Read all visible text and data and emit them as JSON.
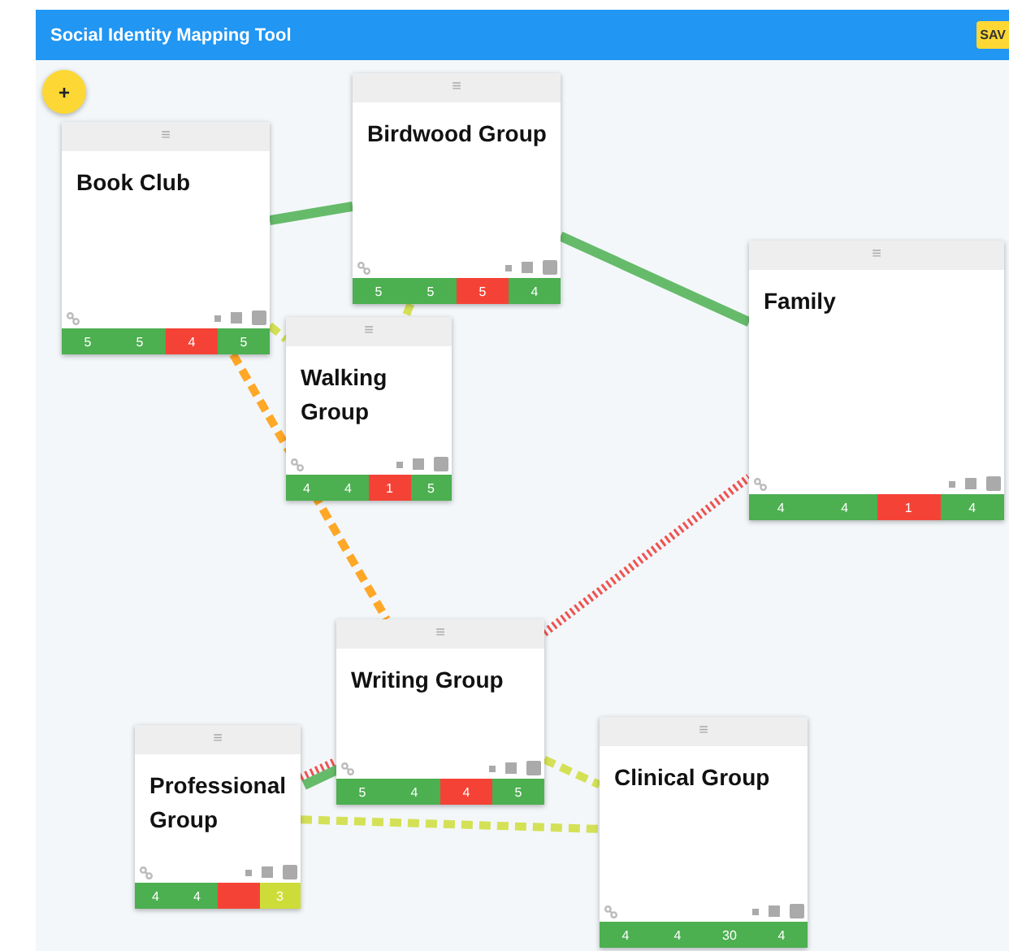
{
  "app_bar": {
    "title": "Social Identity Mapping Tool",
    "save_button": "SAV"
  },
  "add_button": "+",
  "cards": [
    {
      "title": "Book Club",
      "handle": "≡",
      "scores": [
        {
          "value": "5",
          "color": "#4caf50"
        },
        {
          "value": "5",
          "color": "#4caf50"
        },
        {
          "value": "4",
          "color": "#f44336"
        },
        {
          "value": "5",
          "color": "#4caf50"
        }
      ]
    },
    {
      "title": "Birdwood Group",
      "handle": "≡",
      "scores": [
        {
          "value": "5",
          "color": "#4caf50"
        },
        {
          "value": "5",
          "color": "#4caf50"
        },
        {
          "value": "5",
          "color": "#f44336"
        },
        {
          "value": "4",
          "color": "#4caf50"
        }
      ]
    },
    {
      "title": "Walking Group",
      "handle": "≡",
      "scores": [
        {
          "value": "4",
          "color": "#4caf50"
        },
        {
          "value": "4",
          "color": "#4caf50"
        },
        {
          "value": "1",
          "color": "#f44336"
        },
        {
          "value": "5",
          "color": "#4caf50"
        }
      ]
    },
    {
      "title": "Family",
      "handle": "≡",
      "scores": [
        {
          "value": "4",
          "color": "#4caf50"
        },
        {
          "value": "4",
          "color": "#4caf50"
        },
        {
          "value": "1",
          "color": "#f44336"
        },
        {
          "value": "4",
          "color": "#4caf50"
        }
      ]
    },
    {
      "title": "Writing Group",
      "handle": "≡",
      "scores": [
        {
          "value": "5",
          "color": "#4caf50"
        },
        {
          "value": "4",
          "color": "#4caf50"
        },
        {
          "value": "4",
          "color": "#f44336"
        },
        {
          "value": "5",
          "color": "#4caf50"
        }
      ]
    },
    {
      "title": "Professional Group",
      "handle": "≡",
      "scores": [
        {
          "value": "4",
          "color": "#4caf50"
        },
        {
          "value": "4",
          "color": "#4caf50"
        },
        {
          "color": "#f44336"
        },
        {
          "value": "3",
          "color": "#cddc39"
        }
      ]
    },
    {
      "title": "Clinical Group",
      "handle": "≡",
      "scores": [
        {
          "value": "4",
          "color": "#4caf50"
        },
        {
          "value": "4",
          "color": "#4caf50"
        },
        {
          "value": "30",
          "color": "#4caf50"
        },
        {
          "value": "4",
          "color": "#4caf50"
        }
      ]
    }
  ],
  "connections": [
    {
      "kind": "solid",
      "color": "#66bb6a"
    },
    {
      "kind": "solid",
      "color": "#66bb6a"
    },
    {
      "kind": "dashed",
      "color": "#d4e157"
    },
    {
      "kind": "dashed",
      "color": "#d4e157"
    },
    {
      "kind": "dashed",
      "color": "#ffa726"
    },
    {
      "kind": "hatched",
      "color": "#ef5350"
    },
    {
      "kind": "hatched",
      "color": "#ef5350"
    },
    {
      "kind": "solid",
      "color": "#66bb6a"
    },
    {
      "kind": "dashed",
      "color": "#d4e157"
    },
    {
      "kind": "dashed",
      "color": "#d4e157"
    }
  ]
}
